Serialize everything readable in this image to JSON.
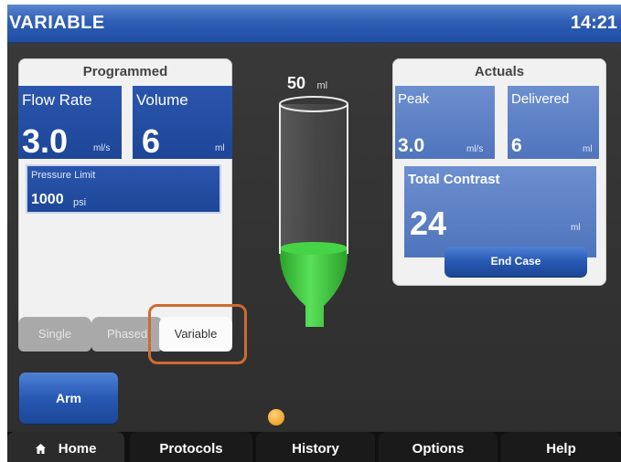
{
  "header": {
    "title": "VARIABLE",
    "clock": "14:21"
  },
  "programmed": {
    "title": "Programmed",
    "flow_rate": {
      "label": "Flow Rate",
      "value": "3.0",
      "unit": "ml/s"
    },
    "volume": {
      "label": "Volume",
      "value": "6",
      "unit": "ml"
    },
    "pressure_limit": {
      "label": "Pressure Limit",
      "value": "1000",
      "unit": "psi"
    }
  },
  "syringe": {
    "volume": "50",
    "unit": "ml",
    "fill_fraction": 0.45
  },
  "actuals": {
    "title": "Actuals",
    "peak": {
      "label": "Peak",
      "value": "3.0",
      "unit": "ml/s"
    },
    "delivered": {
      "label": "Delivered",
      "value": "6",
      "unit": "ml"
    },
    "total_contrast": {
      "label": "Total Contrast",
      "value": "24",
      "unit": "ml"
    },
    "end_case_label": "End Case"
  },
  "modes": [
    {
      "label": "Single",
      "active": false
    },
    {
      "label": "Phased",
      "active": false
    },
    {
      "label": "Variable",
      "active": true
    }
  ],
  "arm_label": "Arm",
  "nav": [
    {
      "label": "Home",
      "icon": "home-icon",
      "active": true
    },
    {
      "label": "Protocols",
      "active": false
    },
    {
      "label": "History",
      "active": false
    },
    {
      "label": "Options",
      "active": false
    },
    {
      "label": "Help",
      "active": false
    }
  ],
  "colors": {
    "accent_blue": "#2458b0",
    "fluid_green": "#3cc83c",
    "highlight": "#d06a30"
  }
}
